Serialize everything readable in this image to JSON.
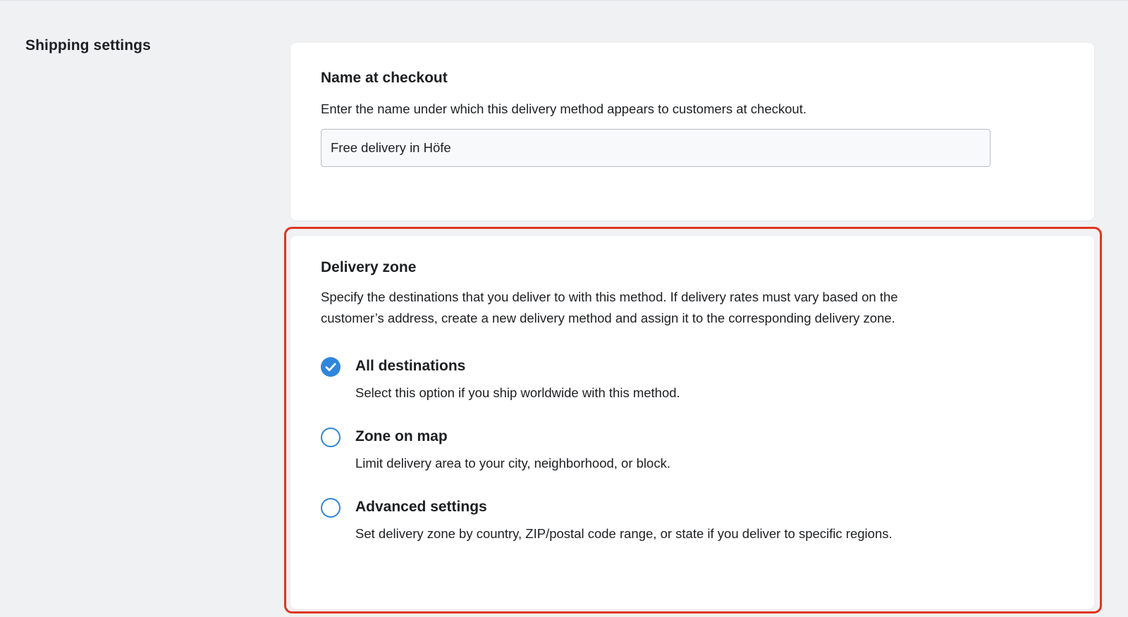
{
  "page": {
    "section_title": "Shipping settings"
  },
  "name_card": {
    "heading": "Name at checkout",
    "description": "Enter the name under which this delivery method appears to customers at checkout.",
    "input_value": "Free delivery in Höfe"
  },
  "zone_card": {
    "heading": "Delivery zone",
    "description_line1": "Specify the destinations that you deliver to with this method. If delivery rates must vary based on the",
    "description_line2": "customer’s address, create a new delivery method and assign it to the corresponding delivery zone.",
    "options": [
      {
        "label": "All destinations",
        "hint": "Select this option if you ship worldwide with this method.",
        "selected": true
      },
      {
        "label": "Zone on map",
        "hint": "Limit delivery area to your city, neighborhood, or block.",
        "selected": false
      },
      {
        "label": "Advanced settings",
        "hint": "Set delivery zone by country, ZIP/postal code range, or state if you deliver to specific regions.",
        "selected": false
      }
    ]
  },
  "colors": {
    "accent": "#2f86dc",
    "highlight_frame": "#e0351f",
    "background": "#f0f1f3",
    "card": "#ffffff"
  },
  "icons": {
    "selected_radio": "check-circle-icon",
    "unselected_radio": "circle-outline-icon"
  }
}
